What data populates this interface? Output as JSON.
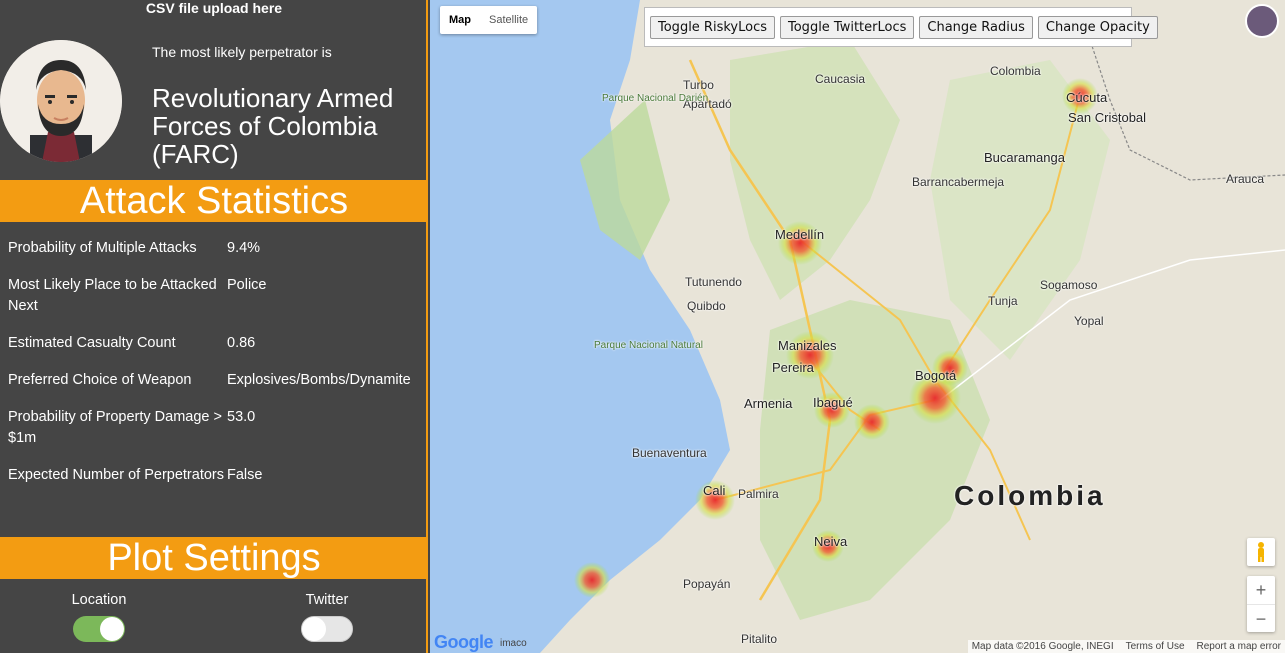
{
  "sidebar": {
    "upload_label": "CSV file upload here",
    "perpetrator_label": "The most likely perpetrator is",
    "perpetrator_name": "Revolutionary Armed Forces of Colombia (FARC)",
    "stats_title": "Attack Statistics",
    "stats": [
      {
        "label": "Probability of Multiple Attacks",
        "value": "9.4%"
      },
      {
        "label": "Most Likely Place to be Attacked Next",
        "value": "Police"
      },
      {
        "label": "Estimated Casualty Count",
        "value": "0.86"
      },
      {
        "label": "Preferred Choice of Weapon",
        "value": "Explosives/Bombs/Dynamite"
      },
      {
        "label": "Probability of Property Damage > $1m",
        "value": "53.0"
      },
      {
        "label": "Expected Number of Perpetrators",
        "value": "False"
      }
    ],
    "plot_title": "Plot Settings",
    "toggles": {
      "location": {
        "label": "Location",
        "on": true
      },
      "twitter": {
        "label": "Twitter",
        "on": false
      }
    }
  },
  "map": {
    "type_buttons": {
      "map": "Map",
      "satellite": "Satellite",
      "active": "Map"
    },
    "controls": {
      "toggle_risky": "Toggle RiskyLocs",
      "toggle_twitter": "Toggle TwitterLocs",
      "change_radius": "Change Radius",
      "change_opacity": "Change Opacity"
    },
    "country_label": "Colombia",
    "cities": [
      "Medellín",
      "Bogotá",
      "Cali",
      "Manizales",
      "Pereira",
      "Ibagué",
      "Armenia",
      "Neiva",
      "Cúcuta",
      "San Cristobal",
      "Bucaramanga",
      "Barrancabermeja",
      "Buenaventura",
      "Palmira",
      "Popayán",
      "Pitalito",
      "Tunja",
      "Sogamoso",
      "Yopal",
      "Tutunendo",
      "Quibdo",
      "Caucasia",
      "Apartadó",
      "Arauca",
      "Colombia",
      "Turbo"
    ],
    "parks": [
      "Parque Nacional Darién",
      "Parque Nacional Natural"
    ],
    "zoom_in": "+",
    "zoom_out": "−",
    "logo": "Google",
    "logo_suffix": "imaco",
    "attribution": {
      "data": "Map data ©2016 Google, INEGI",
      "terms": "Terms of Use",
      "report": "Report a map error"
    },
    "hotspots": [
      "Medellín",
      "Manizales",
      "Ibagué",
      "Bogotá",
      "Cali",
      "Neiva",
      "Cúcuta",
      "Tumaco"
    ]
  }
}
